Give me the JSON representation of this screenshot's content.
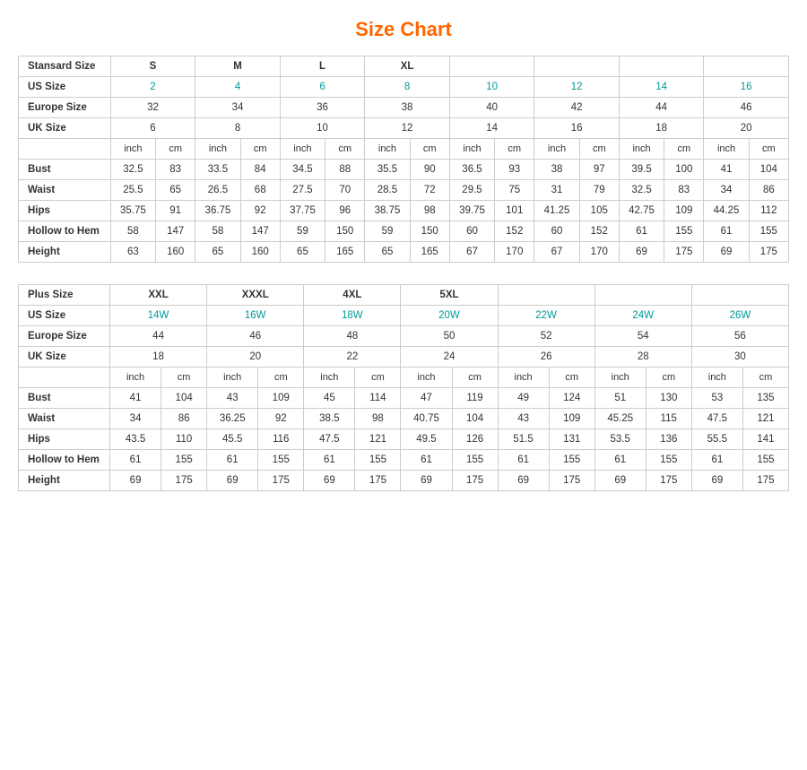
{
  "title": "Size Chart",
  "standard": {
    "groups": [
      {
        "label": "Stansard Size",
        "spans": [
          {
            "text": "S",
            "cols": 2
          },
          {
            "text": "M",
            "cols": 2
          },
          {
            "text": "L",
            "cols": 2
          },
          {
            "text": "XL",
            "cols": 2
          }
        ]
      },
      {
        "label": "US Size",
        "values": [
          "2",
          "4",
          "6",
          "8",
          "10",
          "12",
          "14",
          "16"
        ]
      },
      {
        "label": "Europe Size",
        "values": [
          "32",
          "34",
          "36",
          "38",
          "40",
          "42",
          "44",
          "46"
        ]
      },
      {
        "label": "UK Size",
        "values": [
          "6",
          "8",
          "10",
          "12",
          "14",
          "16",
          "18",
          "20"
        ]
      }
    ],
    "unit_row": [
      "inch",
      "cm",
      "inch",
      "cm",
      "inch",
      "cm",
      "inch",
      "cm",
      "inch",
      "cm",
      "inch",
      "cm",
      "inch",
      "cm",
      "inch",
      "cm"
    ],
    "data_rows": [
      {
        "label": "Bust",
        "values": [
          "32.5",
          "83",
          "33.5",
          "84",
          "34.5",
          "88",
          "35.5",
          "90",
          "36.5",
          "93",
          "38",
          "97",
          "39.5",
          "100",
          "41",
          "104"
        ]
      },
      {
        "label": "Waist",
        "values": [
          "25.5",
          "65",
          "26.5",
          "68",
          "27.5",
          "70",
          "28.5",
          "72",
          "29.5",
          "75",
          "31",
          "79",
          "32.5",
          "83",
          "34",
          "86"
        ]
      },
      {
        "label": "Hips",
        "values": [
          "35.75",
          "91",
          "36.75",
          "92",
          "37.75",
          "96",
          "38.75",
          "98",
          "39.75",
          "101",
          "41.25",
          "105",
          "42.75",
          "109",
          "44.25",
          "112"
        ]
      },
      {
        "label": "Hollow to Hem",
        "values": [
          "58",
          "147",
          "58",
          "147",
          "59",
          "150",
          "59",
          "150",
          "60",
          "152",
          "60",
          "152",
          "61",
          "155",
          "61",
          "155"
        ]
      },
      {
        "label": "Height",
        "values": [
          "63",
          "160",
          "65",
          "160",
          "65",
          "165",
          "65",
          "165",
          "67",
          "170",
          "67",
          "170",
          "69",
          "175",
          "69",
          "175"
        ]
      }
    ]
  },
  "plus": {
    "groups": [
      {
        "label": "Plus Size",
        "spans": [
          {
            "text": "XXL",
            "cols": 2
          },
          {
            "text": "XXXL",
            "cols": 2
          },
          {
            "text": "4XL",
            "cols": 2
          },
          {
            "text": "5XL",
            "cols": 1
          }
        ]
      },
      {
        "label": "US Size",
        "values": [
          "14W",
          "16W",
          "18W",
          "20W",
          "22W",
          "24W",
          "26W"
        ]
      },
      {
        "label": "Europe Size",
        "values": [
          "44",
          "46",
          "48",
          "50",
          "52",
          "54",
          "56"
        ]
      },
      {
        "label": "UK Size",
        "values": [
          "18",
          "20",
          "22",
          "24",
          "26",
          "28",
          "30"
        ]
      }
    ],
    "unit_row": [
      "inch",
      "cm",
      "inch",
      "cm",
      "inch",
      "cm",
      "inch",
      "cm",
      "inch",
      "cm",
      "inch",
      "cm",
      "inch",
      "cm"
    ],
    "data_rows": [
      {
        "label": "Bust",
        "values": [
          "41",
          "104",
          "43",
          "109",
          "45",
          "114",
          "47",
          "119",
          "49",
          "124",
          "51",
          "130",
          "53",
          "135"
        ]
      },
      {
        "label": "Waist",
        "values": [
          "34",
          "86",
          "36.25",
          "92",
          "38.5",
          "98",
          "40.75",
          "104",
          "43",
          "109",
          "45.25",
          "115",
          "47.5",
          "121"
        ]
      },
      {
        "label": "Hips",
        "values": [
          "43.5",
          "110",
          "45.5",
          "116",
          "47.5",
          "121",
          "49.5",
          "126",
          "51.5",
          "131",
          "53.5",
          "136",
          "55.5",
          "141"
        ]
      },
      {
        "label": "Hollow to Hem",
        "values": [
          "61",
          "155",
          "61",
          "155",
          "61",
          "155",
          "61",
          "155",
          "61",
          "155",
          "61",
          "155",
          "61",
          "155"
        ]
      },
      {
        "label": "Height",
        "values": [
          "69",
          "175",
          "69",
          "175",
          "69",
          "175",
          "69",
          "175",
          "69",
          "175",
          "69",
          "175",
          "69",
          "175"
        ]
      }
    ]
  }
}
